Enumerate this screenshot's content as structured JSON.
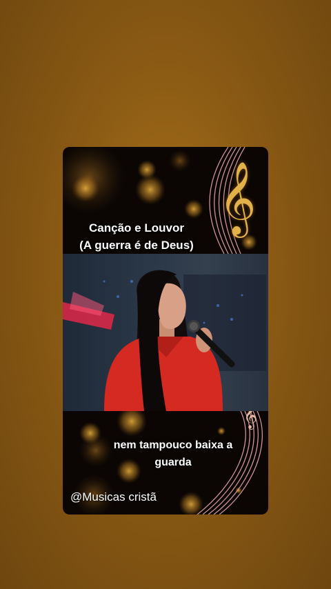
{
  "title": {
    "line1": "Canção e Louvor",
    "line2": "(A guerra é de Deus)"
  },
  "lyrics": {
    "line1": "nem tampouco baixa a",
    "line2": "guarda"
  },
  "handle": "@Musicas cristã",
  "icons": [
    "treble-clef-icon"
  ],
  "colors": {
    "background": "#8a5a14",
    "card": "#0b0604",
    "bokeh": "#d89a2a",
    "staff_lines": "#e0a4a4",
    "clef_gold": "#e2b24a",
    "singer_shirt": "#d42a22"
  }
}
